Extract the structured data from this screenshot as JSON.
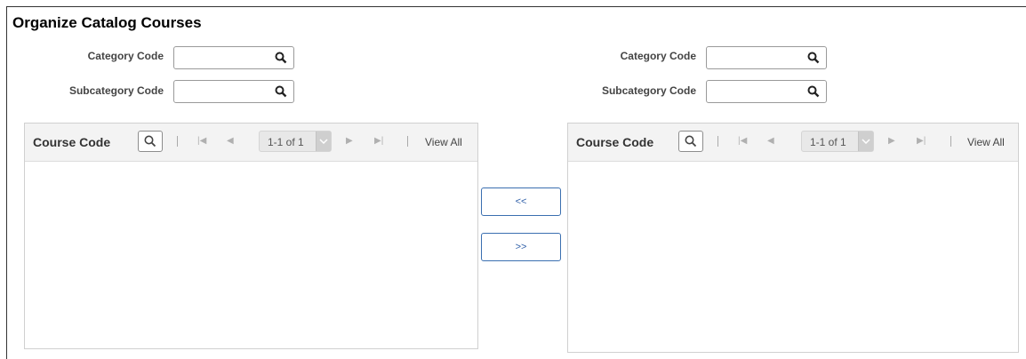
{
  "page": {
    "title": "Organize Catalog Courses"
  },
  "left_filters": {
    "category_label": "Category Code",
    "category_value": "",
    "subcategory_label": "Subcategory Code",
    "subcategory_value": ""
  },
  "right_filters": {
    "category_label": "Category Code",
    "category_value": "",
    "subcategory_label": "Subcategory Code",
    "subcategory_value": ""
  },
  "left_grid": {
    "title": "Course Code",
    "range": "1-1 of 1",
    "view_all": "View All",
    "rows": []
  },
  "right_grid": {
    "title": "Course Code",
    "range": "1-1 of 1",
    "view_all": "View All",
    "rows": []
  },
  "move_buttons": {
    "move_left": "<<",
    "move_right": ">>"
  },
  "icons": [
    "search-icon",
    "first-page-icon",
    "previous-page-icon",
    "next-page-icon",
    "last-page-icon",
    "chevron-down-icon"
  ],
  "colors": {
    "button_border": "#3a6fb0",
    "grid_header": "#f3f3f3"
  }
}
